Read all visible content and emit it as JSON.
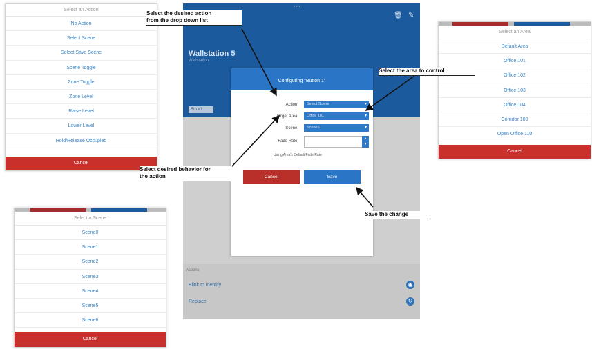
{
  "action_picker": {
    "title": "Select an Action",
    "options": [
      "No Action",
      "Select Scene",
      "Select Save Scene",
      "Scene Toggle",
      "Zone Toggle",
      "Zone Level",
      "Raise Level",
      "Lower Level",
      "Hold/Release Occupied"
    ],
    "cancel": "Cancel"
  },
  "area_picker": {
    "title": "Select an Area",
    "options": [
      "Default Area",
      "Office 101",
      "Office 102",
      "Office 103",
      "Office 104",
      "Corridor 100",
      "Open Office 110"
    ],
    "cancel": "Cancel"
  },
  "scene_picker": {
    "title": "Select a Scene",
    "options": [
      "Scene0",
      "Scene1",
      "Scene2",
      "Scene3",
      "Scene4",
      "Scene5",
      "Scene6"
    ],
    "cancel": "Cancel"
  },
  "app": {
    "device_name": "Wallstation 5",
    "device_type": "Wallstation",
    "button_tag": "Btn #1",
    "footer": {
      "section": "Actions",
      "row1": "Blink to identify",
      "row2": "Replace"
    }
  },
  "dialog": {
    "title": "Configuring \"Button 1\"",
    "action_label": "Action:",
    "action_value": "Select Scene",
    "target_label": "Target Area:",
    "target_value": "Office 101",
    "scene_label": "Scene:",
    "scene_value": "Scene5",
    "fade_label": "Fade Rate:",
    "hint": "Using Area's Default Fade Rate",
    "cancel": "Cancel",
    "save": "Save"
  },
  "annotations": {
    "action": [
      "Select the desired action",
      "from the drop down list"
    ],
    "area": "Select the area to control",
    "behavior": [
      "Select desired behavior for",
      "the action"
    ],
    "save": "Save the change"
  },
  "colors": {
    "brand_blue": "#1c5a9e",
    "accent_blue": "#2f79c9",
    "cancel_red": "#c9302c",
    "link_blue": "#3a86c8"
  }
}
